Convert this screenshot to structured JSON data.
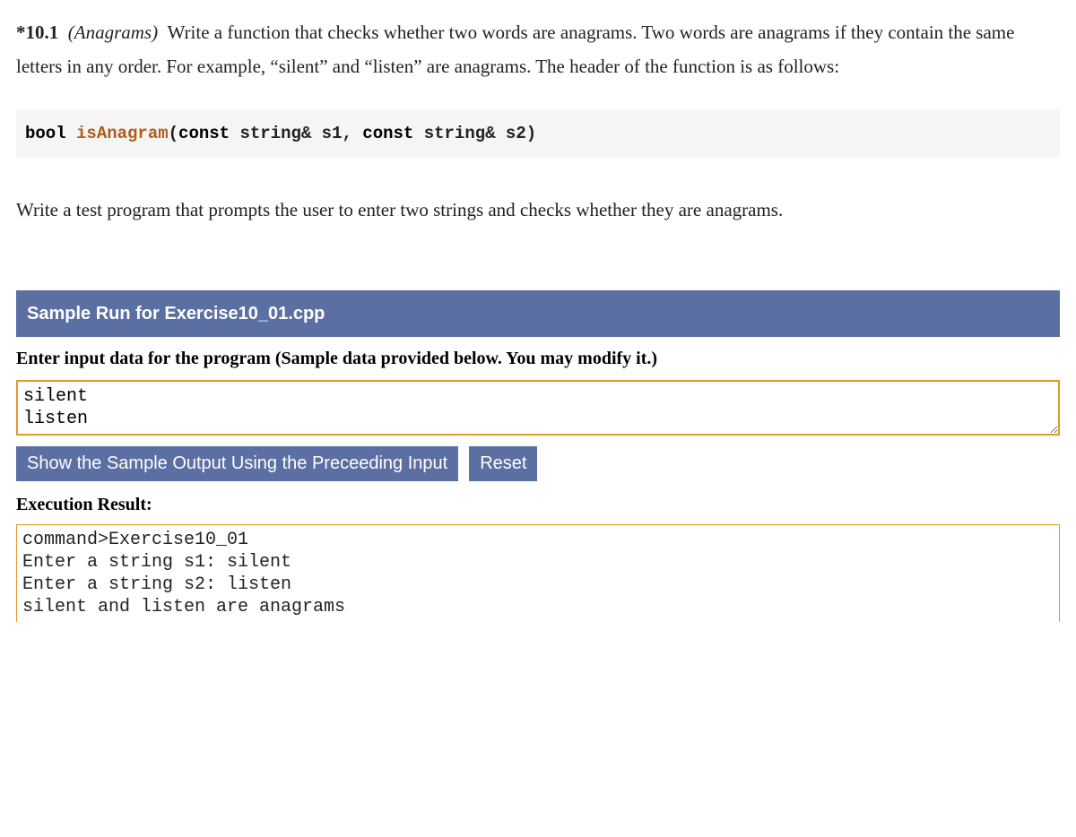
{
  "problem": {
    "number": "*10.1",
    "title": "(Anagrams)",
    "body1": "Write a function that checks whether two words are anagrams. Two words are anagrams if they contain the same letters in any order. For example, “silent” and “listen” are anagrams. The header of the function is as follows:",
    "body2": "Write a test program that prompts the user to enter two strings and checks whether they are anagrams."
  },
  "code": {
    "keyword1": "bool",
    "funcName": "isAnagram",
    "openParen": "(",
    "keyword2": "const",
    "args1": " string& s1, ",
    "keyword3": "const",
    "args2": " string& s2)"
  },
  "sample": {
    "header": "Sample Run for Exercise10_01.cpp",
    "instruction": "Enter input data for the program (Sample data provided below. You may modify it.)",
    "inputData": "silent\nlisten",
    "buttons": {
      "show": "Show the Sample Output Using the Preceeding Input",
      "reset": "Reset"
    },
    "execLabel": "Execution Result:",
    "output": "command>Exercise10_01\nEnter a string s1: silent\nEnter a string s2: listen\nsilent and listen are anagrams"
  }
}
